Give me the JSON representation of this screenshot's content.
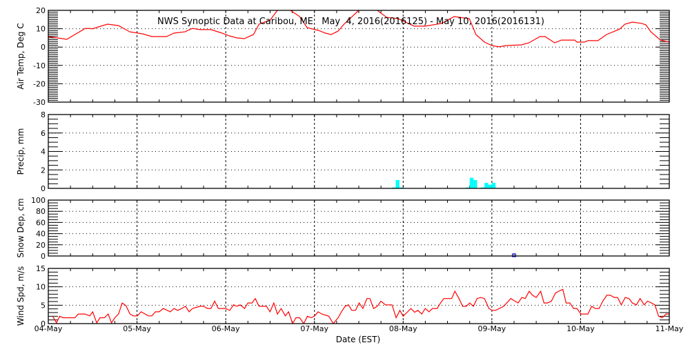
{
  "chart_data": [
    {
      "type": "line",
      "id": "temp",
      "title": "NWS Synoptic Data at Caribou, ME   May  4, 2016(2016125) - May 10, 2016(2016131)",
      "ylabel": "Air Temp, Deg C",
      "ylim": [
        -30,
        20
      ],
      "yticks": [
        -30,
        -20,
        -10,
        0,
        10,
        20
      ],
      "ytick_labels": [
        "-30",
        "-20",
        "-10",
        "0",
        "10",
        "20"
      ],
      "minor_step": 1,
      "color": "#ff0000",
      "x_hours": [
        0,
        5,
        10,
        12,
        16,
        19,
        22,
        25.5,
        28,
        32,
        34,
        37,
        39,
        41,
        44,
        47,
        49,
        51,
        53,
        55.5,
        57,
        60,
        62,
        63.5,
        65.5,
        68,
        70,
        73,
        75,
        76.5,
        78.4,
        80,
        84,
        86,
        89,
        91.5,
        94.6,
        99,
        102,
        106.4,
        109.8,
        113.9,
        115.7,
        118,
        120,
        122,
        123.8,
        128,
        130,
        133,
        134.4,
        137,
        138.8,
        142.4,
        143,
        145,
        146,
        148.7,
        151,
        154.6,
        156,
        158,
        160.5,
        161.7,
        163,
        165.6,
        168
      ],
      "values": [
        5.7,
        4.2,
        10.2,
        10,
        12.5,
        11.7,
        8.3,
        7.2,
        5.7,
        5.7,
        7.6,
        8.3,
        10.2,
        9.5,
        9.5,
        7.6,
        6.1,
        5,
        4.6,
        6.8,
        12.5,
        14.7,
        20,
        22,
        20,
        16.6,
        10.6,
        9.1,
        7.6,
        6.8,
        8.7,
        12.5,
        20,
        22,
        20,
        16.2,
        15.5,
        11.4,
        11.4,
        12.9,
        16.6,
        15.5,
        6.8,
        2.7,
        0.8,
        0.1,
        0.8,
        1.2,
        2.3,
        5.7,
        5.7,
        2.3,
        3.8,
        3.8,
        2.7,
        2.7,
        3.5,
        3.5,
        6.8,
        9.8,
        12.5,
        13.6,
        12.9,
        12.1,
        8.3,
        3.8,
        2.7
      ]
    },
    {
      "type": "bar",
      "id": "precip",
      "ylabel": "Precip, mm",
      "ylim": [
        0,
        8
      ],
      "yticks": [
        0,
        2,
        4,
        6,
        8
      ],
      "ytick_labels": [
        "0",
        "2",
        "4",
        "6",
        "8"
      ],
      "minor_step": 0.5,
      "color": "#00ffff",
      "x_hours": [
        93,
        94,
        95,
        113,
        114,
        115,
        117,
        118,
        119,
        120
      ],
      "values": [
        0.1,
        0.9,
        0.1,
        0.1,
        1.15,
        0.9,
        0.1,
        0.6,
        0.4,
        0.6
      ]
    },
    {
      "type": "scatter",
      "id": "snow",
      "ylabel": "Snow Dep, cm",
      "ylim": [
        0,
        100
      ],
      "yticks": [
        0,
        20,
        40,
        60,
        80,
        100
      ],
      "ytick_labels": [
        "0",
        "20",
        "40",
        "60",
        "80",
        "100"
      ],
      "minor_step": 5,
      "color": "#0000cc",
      "x_hours": [
        126
      ],
      "values": [
        0
      ]
    },
    {
      "type": "line",
      "id": "wind",
      "ylabel": "Wind Spd, m/s",
      "xlabel": "Date (EST)",
      "ylim": [
        0,
        15
      ],
      "yticks": [
        0,
        5,
        10,
        15
      ],
      "ytick_labels": [
        "0",
        "5",
        "10",
        "15"
      ],
      "minor_step": 1,
      "color": "#ff0000",
      "x_hours": [
        1.2,
        2.2,
        3.1,
        4,
        7.2,
        8.1,
        9.9,
        11.2,
        12,
        13.1,
        14,
        15.2,
        16.2,
        17.1,
        18,
        19,
        20,
        21,
        22.1,
        23,
        24.1,
        25.1,
        27.1,
        28,
        29,
        30,
        31.1,
        33,
        34,
        35,
        36.1,
        37.1,
        38.1,
        39,
        40,
        41.1,
        42,
        43.1,
        44,
        45,
        46,
        47.9,
        49.1,
        50.1,
        51,
        51.9,
        53.1,
        54,
        55.1,
        56,
        57,
        59,
        60,
        61,
        62,
        63,
        64.1,
        65,
        66.1,
        67,
        68,
        69.1,
        70.1,
        71.1,
        72,
        73,
        74,
        75.9,
        77.1,
        78.4,
        79.3,
        80.3,
        81.2,
        82.1,
        83.1,
        84.1,
        85.1,
        86.2,
        87,
        88,
        89,
        90,
        91.2,
        93,
        94.1,
        95.1,
        96,
        97.1,
        98.1,
        99.1,
        100,
        101,
        102,
        103,
        103.9,
        105.2,
        106.1,
        107,
        109.1,
        110,
        111.1,
        112.1,
        113.1,
        114,
        115,
        116,
        117,
        118,
        119.2,
        120.1,
        121,
        123.2,
        125.1,
        127.1,
        128.1,
        129,
        130.1,
        131,
        132,
        133.2,
        134.1,
        135,
        136.1,
        137.2,
        138.1,
        139.2,
        140.1,
        141.1,
        142.1,
        143,
        144.1,
        146,
        147,
        148,
        149,
        150,
        151.1,
        152,
        153.1,
        154,
        155,
        156.1,
        157.1,
        158,
        159.1,
        160.1,
        161.2,
        162.1,
        163.2,
        164.1,
        165.1,
        166.1,
        167.1,
        168
      ],
      "values": [
        2,
        0.2,
        2,
        1.6,
        1.6,
        2.6,
        2.6,
        2.1,
        3.2,
        0.2,
        1.6,
        1.6,
        2.6,
        0.2,
        1.6,
        2.6,
        5.6,
        4.9,
        2.6,
        2.1,
        2.1,
        3.2,
        2.1,
        2.1,
        3.2,
        3.2,
        4.1,
        3.2,
        4.1,
        3.6,
        4.1,
        4.7,
        3.2,
        4.1,
        4.4,
        4.7,
        4.7,
        4.1,
        4.1,
        6.1,
        4.1,
        4.1,
        3.6,
        5.1,
        4.7,
        5.1,
        4.1,
        5.6,
        5.6,
        6.8,
        4.7,
        4.7,
        3.2,
        5.6,
        2.6,
        4.1,
        2.1,
        3.2,
        0,
        1.6,
        1.6,
        0,
        2,
        1.6,
        2,
        3.2,
        2.6,
        2,
        0,
        1.6,
        3.2,
        4.7,
        5.1,
        3.6,
        3.6,
        5.6,
        4.1,
        6.8,
        6.8,
        4.1,
        4.7,
        6.1,
        5.1,
        5.1,
        1.6,
        3.6,
        2,
        3.1,
        4.1,
        3.1,
        3.6,
        2.6,
        4.1,
        3.2,
        4.1,
        4.1,
        5.6,
        6.8,
        6.8,
        8.8,
        6.8,
        4.7,
        4.7,
        5.6,
        4.7,
        6.8,
        7.1,
        6.8,
        4.1,
        3.6,
        3.6,
        4.7,
        6.8,
        5.6,
        7.1,
        6.8,
        8.8,
        7.7,
        7.1,
        8.8,
        5.6,
        5.6,
        6.1,
        8.3,
        8.8,
        9.3,
        5.6,
        5.6,
        4.1,
        4.1,
        2.6,
        2.6,
        4.7,
        4.1,
        4.1,
        6.1,
        7.7,
        7.7,
        7.1,
        7.1,
        5.1,
        7.1,
        6.8,
        5.6,
        5.1,
        6.8,
        5.1,
        6.1,
        5.6,
        5.1,
        2,
        1.6,
        2.6,
        2.6
      ]
    }
  ],
  "x_axis": {
    "range_hours": [
      0,
      168
    ],
    "tick_labels": [
      "04-May",
      "05-May",
      "06-May",
      "07-May",
      "08-May",
      "09-May",
      "10-May",
      "11-May"
    ],
    "minor_step_hours": 6
  }
}
